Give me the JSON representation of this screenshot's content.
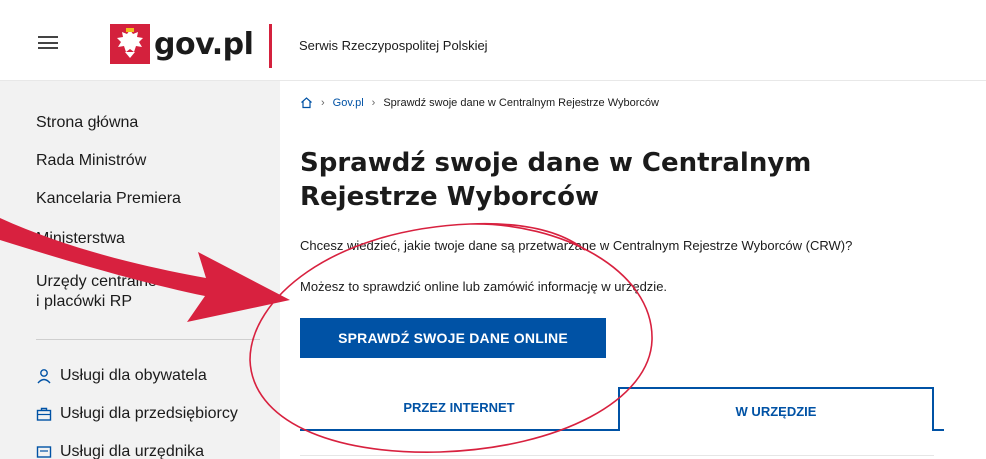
{
  "header": {
    "logo_text": "gov.pl",
    "service_name": "Serwis Rzeczypospolitej Polskiej"
  },
  "sidebar": {
    "nav_items": [
      {
        "label": "Strona główna"
      },
      {
        "label": "Rada Ministrów"
      },
      {
        "label": "Kancelaria Premiera"
      },
      {
        "label": "Ministerstwa"
      },
      {
        "label": "Urzędy centralne"
      },
      {
        "label": "i placówki RP"
      }
    ],
    "service_items": [
      {
        "label": "Usługi dla obywatela",
        "icon": "person-icon"
      },
      {
        "label": "Usługi dla przedsiębiorcy",
        "icon": "briefcase-icon"
      },
      {
        "label": "Usługi dla urzędnika",
        "icon": "card-icon"
      }
    ]
  },
  "breadcrumb": {
    "home_icon": "home-icon",
    "items": [
      "Gov.pl",
      "Sprawdź swoje dane w Centralnym Rejestrze Wyborców"
    ]
  },
  "main": {
    "title": "Sprawdź swoje dane w Centralnym Rejestrze Wyborców",
    "paragraph1": "Chcesz wiedzieć, jakie twoje dane są przetwarzane w Centralnym Rejestrze Wyborców (CRW)?",
    "paragraph2": "Możesz to sprawdzić online lub zamówić informację w urzędzie.",
    "cta_label": "SPRAWDŹ SWOJE DANE ONLINE",
    "tabs": [
      {
        "label": "PRZEZ INTERNET"
      },
      {
        "label": "W URZĘDZIE"
      }
    ]
  },
  "colors": {
    "brand_blue": "#0052a5",
    "brand_red": "#d4213d",
    "annotation_red": "#d8213f",
    "sidebar_bg": "#f2f2f2"
  }
}
